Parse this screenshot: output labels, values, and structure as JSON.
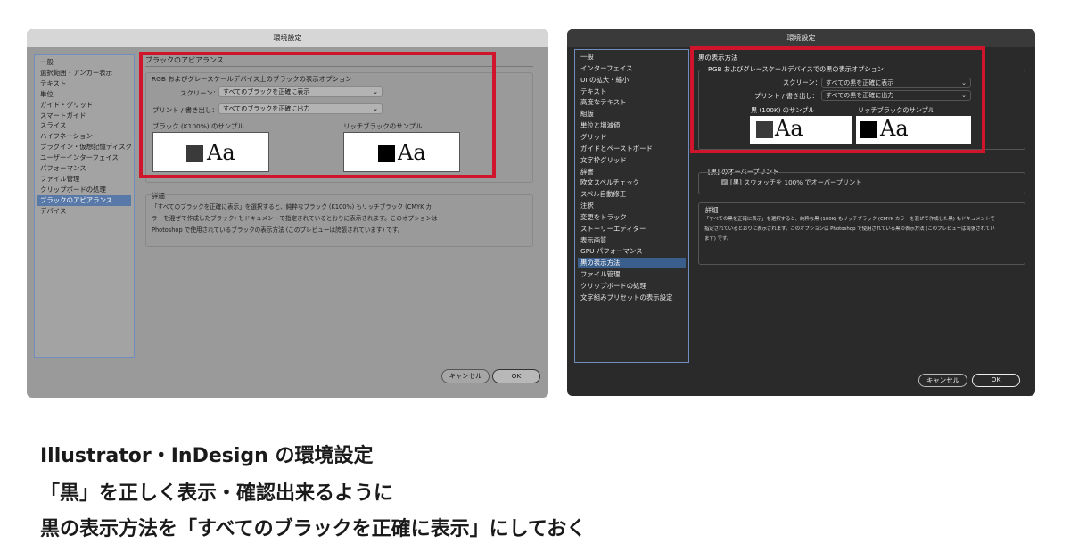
{
  "left_dialog": {
    "title": "環境設定",
    "sidebar": [
      "一般",
      "選択範囲・アンカー表示",
      "テキスト",
      "単位",
      "ガイド・グリッド",
      "スマートガイド",
      "スライス",
      "ハイフネーション",
      "プラグイン・仮想記憶ディスク",
      "ユーザーインターフェイス",
      "パフォーマンス",
      "ファイル管理",
      "クリップボードの処理",
      "ブラックのアピアランス",
      "デバイス"
    ],
    "selected_index": 13,
    "section_title": "ブラックのアピアランス",
    "options_group_title": "RGB およびグレースケールデバイス上のブラックの表示オプション",
    "screen_label": "スクリーン：",
    "screen_value": "すべてのブラックを正確に表示",
    "print_label": "プリント / 書き出し：",
    "print_value": "すべてのブラックを正確に出力",
    "sample_k100_label": "ブラック (K100%) のサンプル",
    "sample_rich_label": "リッチブラックのサンプル",
    "sample_text": "Aa",
    "details_title": "詳細",
    "details_lines": [
      "「すべてのブラックを正確に表示」を選択すると、純粋なブラック (K100%) もリッチブラック (CMYK カ",
      "ラーを混ぜて作成したブラック) もドキュメントで指定されているとおりに表示されます。このオプションは",
      "Photoshop で使用されているブラックの表示方法 (このプレビューは誇張されています) です。"
    ],
    "cancel_label": "キャンセル",
    "ok_label": "OK"
  },
  "right_dialog": {
    "title": "環境設定",
    "sidebar": [
      "一般",
      "インターフェイス",
      "UI の拡大・縮小",
      "テキスト",
      "高度なテキスト",
      "組版",
      "単位と増減値",
      "グリッド",
      "ガイドとペーストボード",
      "文字枠グリッド",
      "辞書",
      "欧文スペルチェック",
      "スペル自動修正",
      "注釈",
      "変更をトラック",
      "ストーリーエディター",
      "表示画質",
      "GPU パフォーマンス",
      "黒の表示方法",
      "ファイル管理",
      "クリップボードの処理",
      "文字組みプリセットの表示設定"
    ],
    "selected_index": 18,
    "section_title": "黒の表示方法",
    "options_group_title": "RGB およびグレースケールデバイスでの黒の表示オプション",
    "screen_label": "スクリーン：",
    "screen_value": "すべての黒を正確に表示",
    "print_label": "プリント / 書き出し：",
    "print_value": "すべての黒を正確に出力",
    "sample_k100_label": "黒 (100K) のサンプル",
    "sample_rich_label": "リッチブラックのサンプル",
    "sample_text": "Aa",
    "overprint_title": "[黒] のオーバープリント",
    "overprint_checkbox_label": "[黒] スウォッチを 100% でオーバープリント",
    "details_title": "詳細",
    "details_lines": [
      "「すべての黒を正確に表示」を選択すると、純粋な黒 (100K) もリッチブラック (CMYK カラーを混ぜて作成した黒) もドキュメントで",
      "指定されているとおりに表示されます。このオプションは Photoshop で使用されている黒の表示方法 (このプレビューは誇張されてい",
      "ます) です。"
    ],
    "cancel_label": "キャンセル",
    "ok_label": "OK"
  },
  "caption_lines": [
    "Illustrator・InDesign の環境設定",
    "「黒」を正しく表示・確認出来るように",
    "黒の表示方法を「すべてのブラックを正確に表示」にしておく"
  ],
  "colors": {
    "highlight": "#d0142c",
    "selection_light": "#5879a8",
    "selection_dark": "#3b5f8c"
  }
}
